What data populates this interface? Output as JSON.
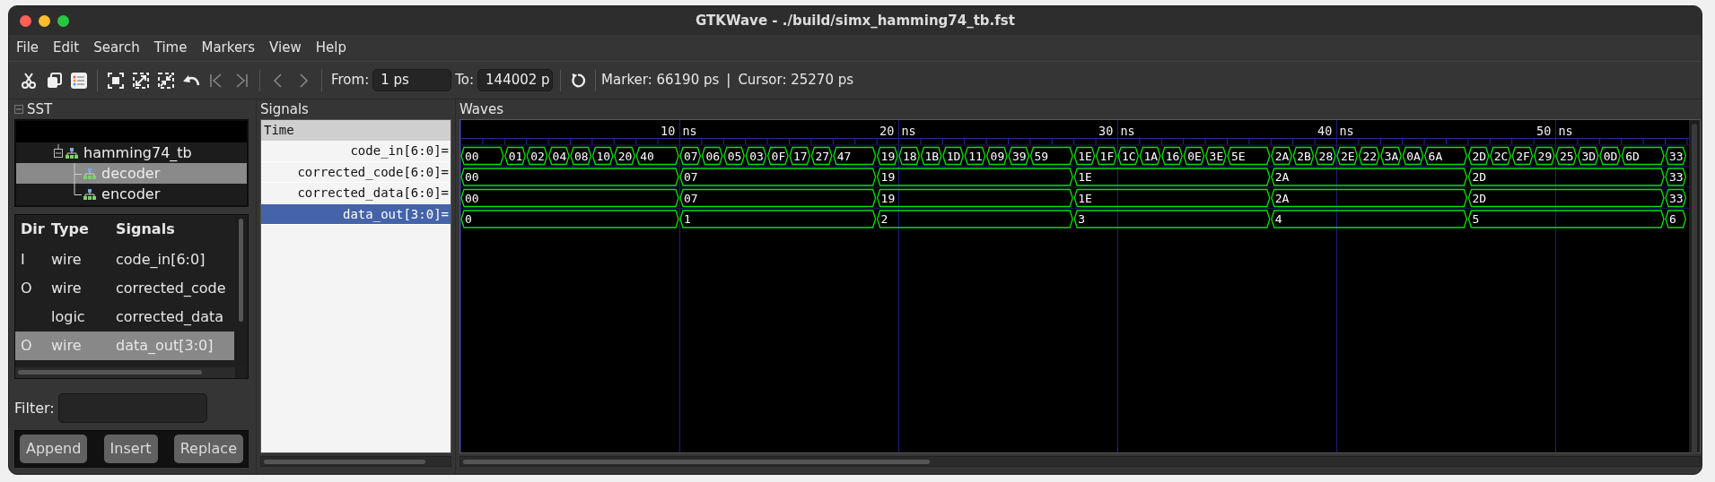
{
  "window": {
    "title": "GTKWave - ./build/simx_hamming74_tb.fst"
  },
  "menu": [
    "File",
    "Edit",
    "Search",
    "Time",
    "Markers",
    "View",
    "Help"
  ],
  "toolbar": {
    "buttons": [
      {
        "kind": "cut",
        "disabled": false
      },
      {
        "kind": "copy",
        "disabled": false
      },
      {
        "kind": "paste",
        "disabled": false
      },
      {
        "kind": "sep"
      },
      {
        "kind": "zoom-fit",
        "disabled": false
      },
      {
        "kind": "zoom-in",
        "disabled": false
      },
      {
        "kind": "zoom-out",
        "disabled": false
      },
      {
        "kind": "undo",
        "disabled": false
      },
      {
        "kind": "to-start",
        "disabled": true
      },
      {
        "kind": "to-end",
        "disabled": true
      },
      {
        "kind": "sep"
      },
      {
        "kind": "prev",
        "disabled": true
      },
      {
        "kind": "next",
        "disabled": true
      }
    ],
    "from": {
      "label": "From:",
      "value": "1 ps"
    },
    "to": {
      "label": "To:",
      "value": "144002 p"
    },
    "status": [
      "Marker: 66190 ps",
      "|",
      "Cursor: 25270 ps"
    ]
  },
  "sst": {
    "title": "SST",
    "tree": [
      {
        "label": "hamming74_tb",
        "selected": false,
        "expanded": true,
        "children": [
          {
            "label": "decoder",
            "selected": true
          },
          {
            "label": "encoder",
            "selected": false
          }
        ]
      }
    ]
  },
  "signal_table": {
    "columns": [
      "Dir",
      "Type",
      "Signals"
    ],
    "rows": [
      {
        "dir": "I",
        "type": "wire",
        "name": "code_in[6:0]",
        "selected": false
      },
      {
        "dir": "O",
        "type": "wire",
        "name": "corrected_code",
        "selected": false
      },
      {
        "type": "logic",
        "name": "corrected_data",
        "selected": false
      },
      {
        "dir": "O",
        "type": "wire",
        "name": "data_out[3:0]",
        "selected": true
      }
    ]
  },
  "filter": {
    "label": "Filter:"
  },
  "buttons": [
    "Append",
    "Insert",
    "Replace"
  ],
  "signals": {
    "title": "Signals",
    "header": "Time",
    "items": [
      {
        "label": "code_in[6:0]=",
        "selected": false
      },
      {
        "label": "corrected_code[6:0]=",
        "selected": false
      },
      {
        "label": "corrected_data[6:0]=",
        "selected": false
      },
      {
        "label": "data_out[3:0]=",
        "selected": true
      }
    ]
  },
  "waves": {
    "title": "Waves",
    "time_labels": [
      "10 ns",
      "20 ns",
      "30 ns",
      "40 ns",
      "50 ns"
    ],
    "groups": [
      {
        "code_in": [
          {
            "value": "00",
            "long": true
          },
          {
            "value": "01",
            "long": false
          },
          {
            "value": "02",
            "long": false
          },
          {
            "value": "04",
            "long": false
          },
          {
            "value": "08",
            "long": false
          },
          {
            "value": "10",
            "long": false
          },
          {
            "value": "20",
            "long": false
          },
          {
            "value": "40",
            "long": true
          }
        ],
        "corrected_code": "00",
        "corrected_data": "00",
        "data_out": "0"
      },
      {
        "code_in": [
          {
            "value": "07",
            "long": false
          },
          {
            "value": "06",
            "long": false
          },
          {
            "value": "05",
            "long": false
          },
          {
            "value": "03",
            "long": false
          },
          {
            "value": "0F",
            "long": false
          },
          {
            "value": "17",
            "long": false
          },
          {
            "value": "27",
            "long": false
          },
          {
            "value": "47",
            "long": true
          }
        ],
        "corrected_code": "07",
        "corrected_data": "07",
        "data_out": "1"
      },
      {
        "code_in": [
          {
            "value": "19",
            "long": false
          },
          {
            "value": "18",
            "long": false
          },
          {
            "value": "1B",
            "long": false
          },
          {
            "value": "1D",
            "long": false
          },
          {
            "value": "11",
            "long": false
          },
          {
            "value": "09",
            "long": false
          },
          {
            "value": "39",
            "long": false
          },
          {
            "value": "59",
            "long": true
          }
        ],
        "corrected_code": "19",
        "corrected_data": "19",
        "data_out": "2"
      },
      {
        "code_in": [
          {
            "value": "1E",
            "long": false
          },
          {
            "value": "1F",
            "long": false
          },
          {
            "value": "1C",
            "long": false
          },
          {
            "value": "1A",
            "long": false
          },
          {
            "value": "16",
            "long": false
          },
          {
            "value": "0E",
            "long": false
          },
          {
            "value": "3E",
            "long": false
          },
          {
            "value": "5E",
            "long": true
          }
        ],
        "corrected_code": "1E",
        "corrected_data": "1E",
        "data_out": "3"
      },
      {
        "code_in": [
          {
            "value": "2A",
            "long": false
          },
          {
            "value": "2B",
            "long": false
          },
          {
            "value": "28",
            "long": false
          },
          {
            "value": "2E",
            "long": false
          },
          {
            "value": "22",
            "long": false
          },
          {
            "value": "3A",
            "long": false
          },
          {
            "value": "0A",
            "long": false
          },
          {
            "value": "6A",
            "long": true
          }
        ],
        "corrected_code": "2A",
        "corrected_data": "2A",
        "data_out": "4"
      },
      {
        "code_in": [
          {
            "value": "2D",
            "long": false
          },
          {
            "value": "2C",
            "long": false
          },
          {
            "value": "2F",
            "long": false
          },
          {
            "value": "29",
            "long": false
          },
          {
            "value": "25",
            "long": false
          },
          {
            "value": "3D",
            "long": false
          },
          {
            "value": "0D",
            "long": false
          },
          {
            "value": "6D",
            "long": true
          }
        ],
        "corrected_code": "2D",
        "corrected_data": "2D",
        "data_out": "5"
      },
      {
        "code_in": [
          {
            "value": "33",
            "long": false
          }
        ],
        "corrected_code": "33",
        "corrected_data": "33",
        "data_out": "6"
      }
    ]
  }
}
